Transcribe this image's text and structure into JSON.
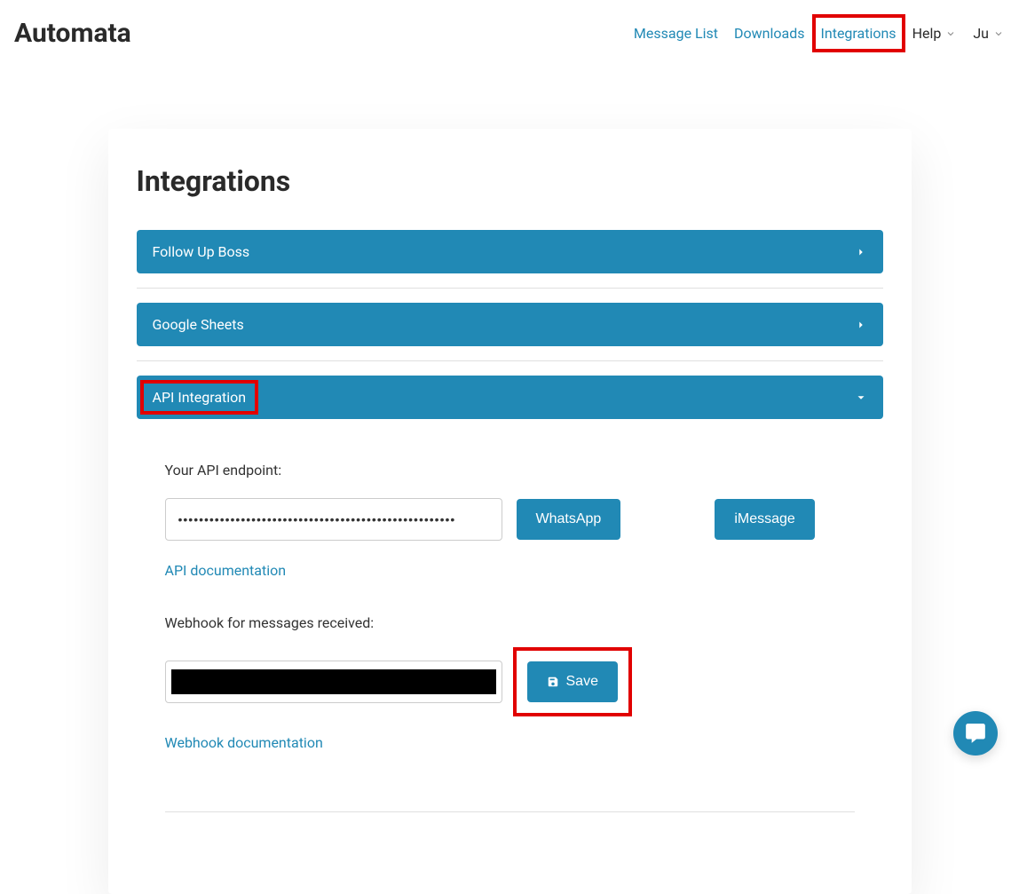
{
  "header": {
    "logo": "Automata",
    "nav": {
      "message_list": "Message List",
      "downloads": "Downloads",
      "integrations": "Integrations",
      "help": "Help",
      "user": "Ju"
    }
  },
  "page": {
    "title": "Integrations"
  },
  "accordion": {
    "follow_up_boss": "Follow Up Boss",
    "google_sheets": "Google Sheets",
    "api_integration": "API Integration"
  },
  "api_section": {
    "endpoint_label": "Your API endpoint:",
    "endpoint_value": "•••••••••••••••••••••••••••••••••••••••••••••••••••••",
    "whatsapp_btn": "WhatsApp",
    "imessage_btn": "iMessage",
    "api_doc_link": "API documentation",
    "webhook_label": "Webhook for messages received:",
    "save_btn": "Save",
    "webhook_doc_link": "Webhook documentation"
  }
}
